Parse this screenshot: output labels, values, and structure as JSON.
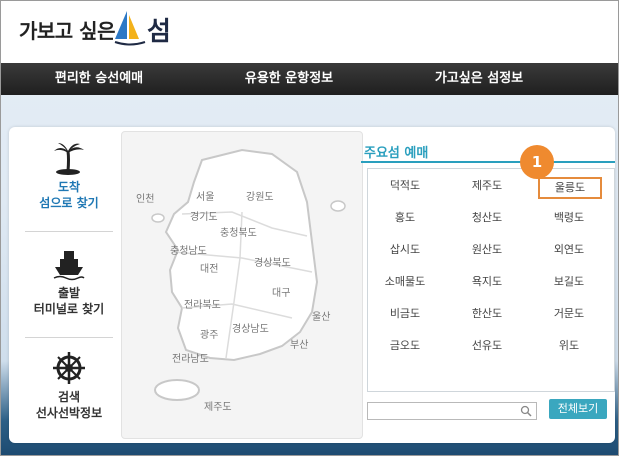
{
  "header": {
    "logo_text": "가보고 싶은",
    "logo_isle": "섬"
  },
  "nav": {
    "items": [
      "편리한 승선예매",
      "유용한 운항정보",
      "가고싶은 섬정보"
    ]
  },
  "sidebar": {
    "items": [
      {
        "line1": "도착",
        "line2": "섬으로 찾기",
        "icon": "palm-island-icon",
        "active": true
      },
      {
        "line1": "출발",
        "line2": "터미널로 찾기",
        "icon": "ship-icon",
        "active": false
      },
      {
        "line1": "검색",
        "line2": "선사선박정보",
        "icon": "ship-wheel-icon",
        "active": false
      }
    ]
  },
  "map": {
    "labels": [
      "인천",
      "서울",
      "강원도",
      "경기도",
      "충청북도",
      "충청남도",
      "대전",
      "경상북도",
      "전라북도",
      "대구",
      "울산",
      "광주",
      "경상남도",
      "부산",
      "전라남도",
      "제주도"
    ]
  },
  "islands": {
    "title": "주요섬 예매",
    "grid": [
      [
        "덕적도",
        "제주도",
        "울릉도"
      ],
      [
        "홍도",
        "청산도",
        "백령도"
      ],
      [
        "삽시도",
        "원산도",
        "외연도"
      ],
      [
        "소매물도",
        "욕지도",
        "보길도"
      ],
      [
        "비금도",
        "한산도",
        "거문도"
      ],
      [
        "금오도",
        "선유도",
        "위도"
      ]
    ],
    "highlight": "울릉도",
    "badge": "1",
    "search_placeholder": "",
    "all_button": "전체보기"
  },
  "colors": {
    "accent": "#2a9fbe",
    "highlight": "#e58b3c",
    "nav_bg": "#2a2a2a"
  }
}
